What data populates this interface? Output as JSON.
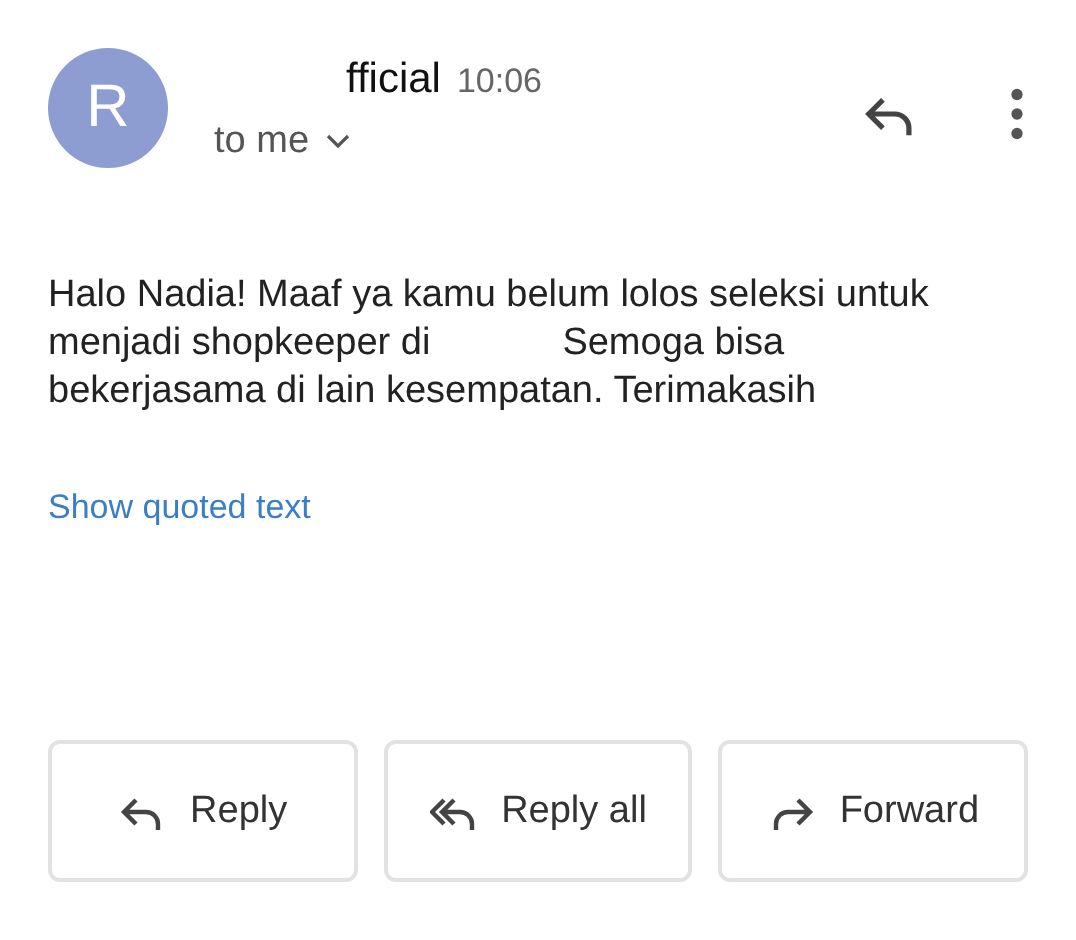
{
  "message": {
    "avatar_letter": "R",
    "sender": "fficial",
    "time": "10:06",
    "recipient": "to me",
    "body_lines": [
      [
        {
          "kind": "text",
          "text": "Halo Nadia! Maaf ya kamu belum lolos seleksi untuk"
        }
      ],
      [
        {
          "kind": "text",
          "text": "menjadi shopkeeper di"
        },
        {
          "kind": "redacted"
        },
        {
          "kind": "text",
          "text": "Semoga bisa"
        }
      ],
      [
        {
          "kind": "text",
          "text": "bekerjasama di lain kesempatan. Terimakasih"
        }
      ]
    ],
    "quoted_link": "Show quoted text"
  },
  "actions": [
    {
      "kind": "reply",
      "label": "Reply"
    },
    {
      "kind": "reply_all",
      "label": "Reply all"
    },
    {
      "kind": "forward",
      "label": "Forward"
    }
  ]
}
